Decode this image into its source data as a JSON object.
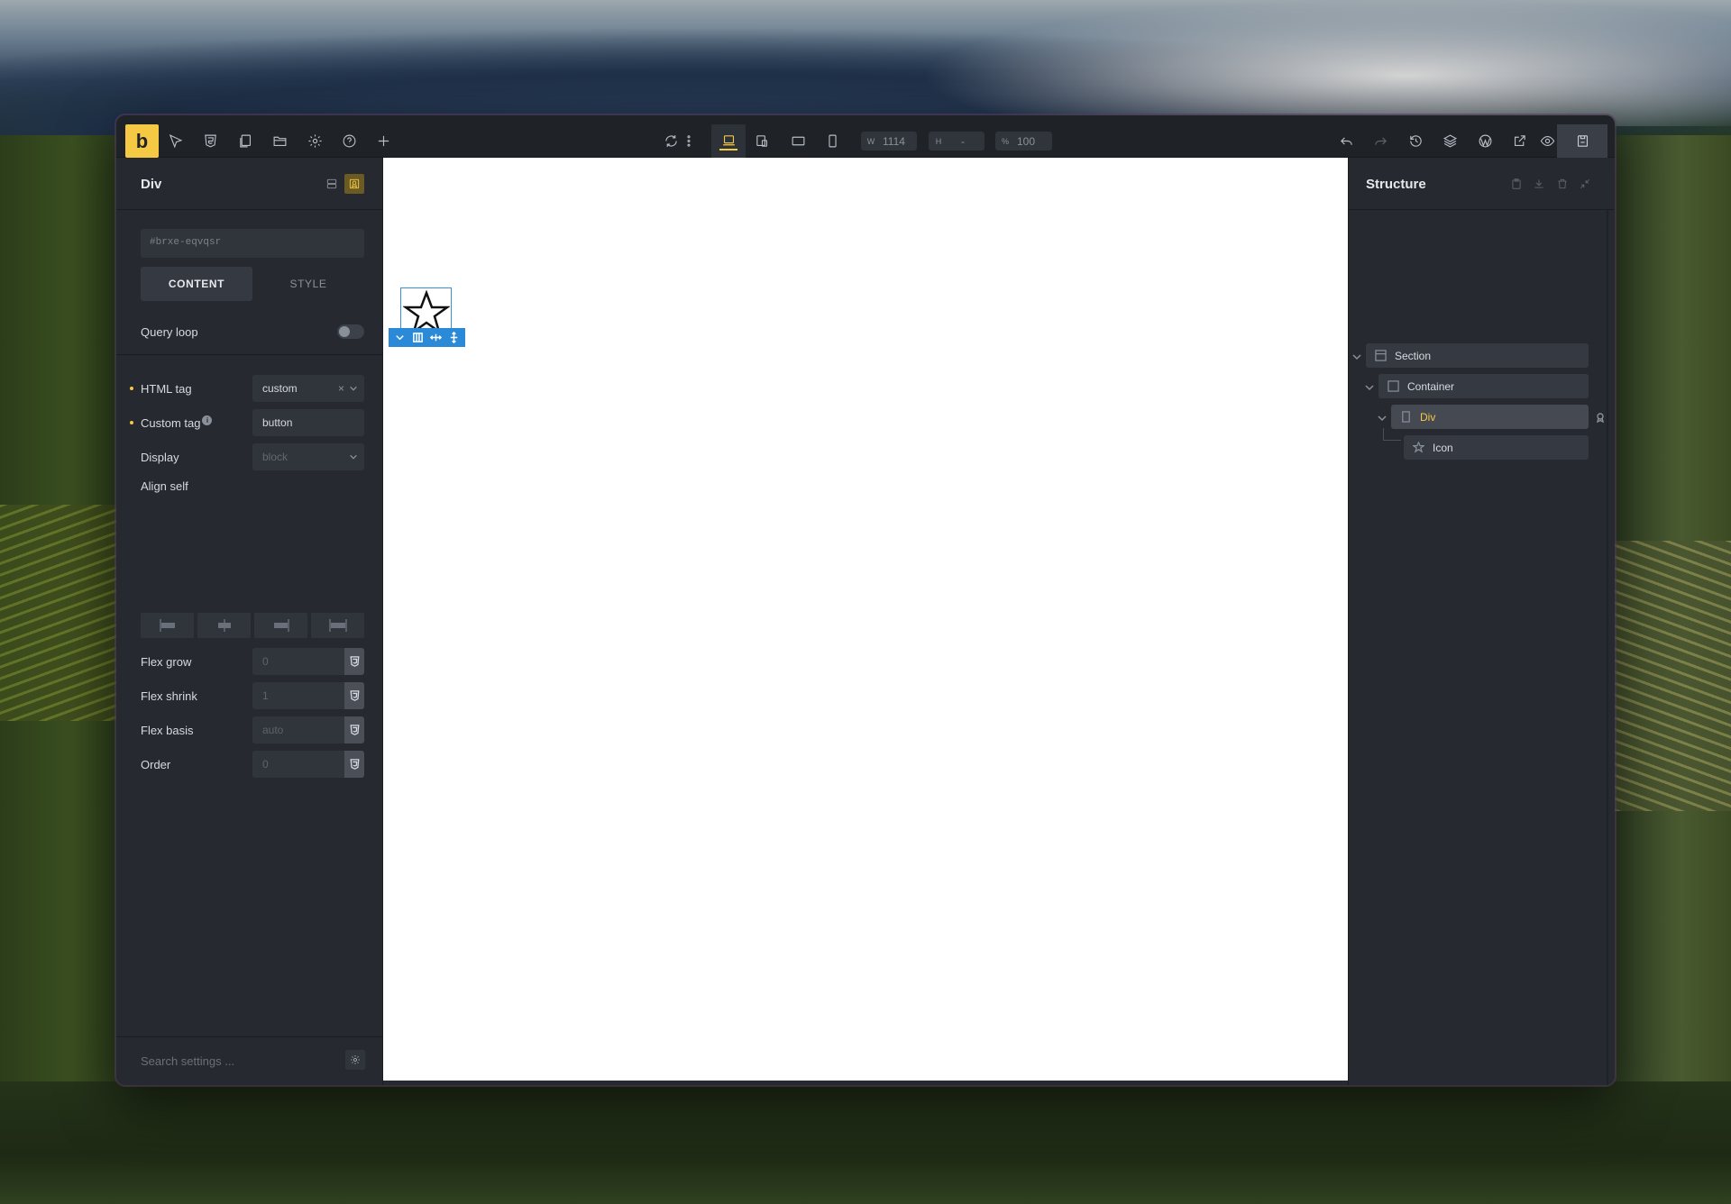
{
  "app": {
    "logo_letter": "b",
    "accent_color": "#f6c945",
    "selection_color": "#2b8ad8"
  },
  "toolbar": {
    "left_icons": [
      "cursor-icon",
      "css3-icon",
      "pages-icon",
      "folder-icon",
      "gear-icon",
      "help-icon",
      "add-icon"
    ],
    "center_icons": [
      "refresh-icon",
      "more-vertical-icon",
      "desktop-icon",
      "responsive-icon",
      "tablet-landscape-icon",
      "mobile-icon"
    ],
    "width_label": "W",
    "width_value": "1114",
    "height_label": "H",
    "height_value": "-",
    "zoom_label": "%",
    "zoom_value": "100",
    "right_icons": [
      "undo-icon",
      "redo-icon",
      "history-icon",
      "layers-icon",
      "wordpress-icon",
      "external-link-icon",
      "preview-eye-icon",
      "save-icon"
    ]
  },
  "left_panel": {
    "title": "Div",
    "id_value": "#brxe-eqvqsr",
    "tabs": {
      "content": "CONTENT",
      "style": "STYLE"
    },
    "query_loop": {
      "label": "Query loop",
      "enabled": false
    },
    "html_tag": {
      "label": "HTML tag",
      "value": "custom",
      "clear": "×"
    },
    "custom_tag": {
      "label": "Custom tag",
      "info": "i",
      "value": "button"
    },
    "display": {
      "label": "Display",
      "value": "block"
    },
    "align_self": {
      "label": "Align self"
    },
    "flex_grow": {
      "label": "Flex grow",
      "placeholder": "0"
    },
    "flex_shrink": {
      "label": "Flex shrink",
      "placeholder": "1"
    },
    "flex_basis": {
      "label": "Flex basis",
      "placeholder": "auto"
    },
    "order": {
      "label": "Order",
      "placeholder": "0"
    },
    "search_placeholder": "Search settings ..."
  },
  "structure": {
    "title": "Structure",
    "items": [
      {
        "label": "Section",
        "icon": "section-icon"
      },
      {
        "label": "Container",
        "icon": "container-icon"
      },
      {
        "label": "Div",
        "icon": "div-icon",
        "selected": true
      },
      {
        "label": "Icon",
        "icon": "star-icon"
      }
    ]
  }
}
